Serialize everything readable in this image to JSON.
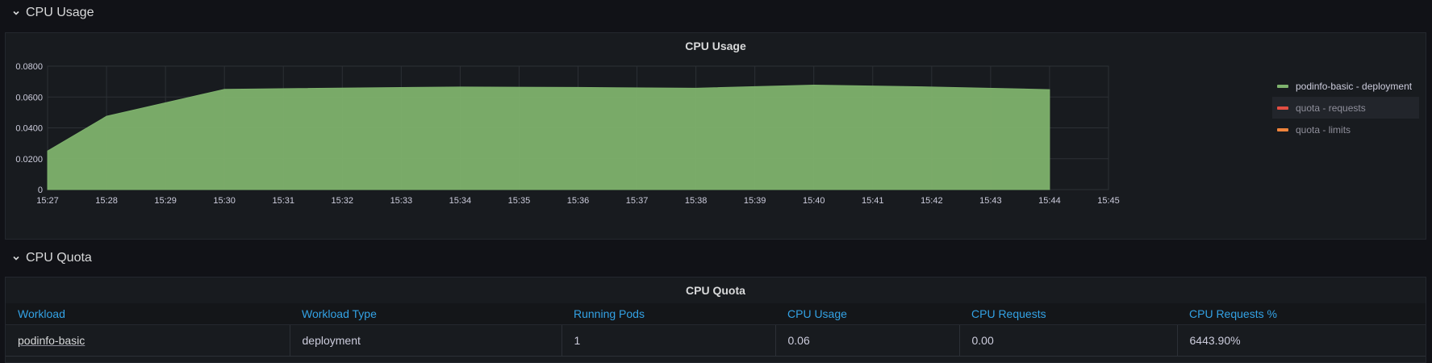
{
  "rows": {
    "cpu_usage": {
      "title": "CPU Usage"
    },
    "cpu_quota": {
      "title": "CPU Quota"
    }
  },
  "usage_panel": {
    "title": "CPU Usage",
    "legend": [
      {
        "label": "podinfo-basic - deployment",
        "color": "#7eb26d"
      },
      {
        "label": "quota - requests",
        "color": "#e24d42"
      },
      {
        "label": "quota - limits",
        "color": "#ef843c"
      }
    ]
  },
  "chart_data": {
    "type": "area",
    "title": "CPU Usage",
    "xlabel": "",
    "ylabel": "",
    "x_ticks": [
      "15:27",
      "15:28",
      "15:29",
      "15:30",
      "15:31",
      "15:32",
      "15:33",
      "15:34",
      "15:35",
      "15:36",
      "15:37",
      "15:38",
      "15:39",
      "15:40",
      "15:41",
      "15:42",
      "15:43",
      "15:44",
      "15:45"
    ],
    "y_ticks": [
      "0",
      "0.0200",
      "0.0400",
      "0.0600",
      "0.0800"
    ],
    "ylim": [
      0,
      0.08
    ],
    "grid": true,
    "legend_position": "right",
    "series": [
      {
        "name": "podinfo-basic - deployment",
        "color": "#7eb26d",
        "x": [
          "15:27",
          "15:28",
          "15:30",
          "15:34",
          "15:36",
          "15:38",
          "15:40",
          "15:42",
          "15:44"
        ],
        "values": [
          0.025,
          0.0475,
          0.065,
          0.0665,
          0.0662,
          0.0657,
          0.0677,
          0.0665,
          0.0648
        ]
      },
      {
        "name": "quota - requests",
        "color": "#e24d42",
        "x": [],
        "values": []
      },
      {
        "name": "quota - limits",
        "color": "#ef843c",
        "x": [],
        "values": []
      }
    ]
  },
  "quota_panel": {
    "title": "CPU Quota",
    "columns": [
      "Workload",
      "Workload Type",
      "Running Pods",
      "CPU Usage",
      "CPU Requests",
      "CPU Requests %"
    ],
    "rows": [
      [
        "podinfo-basic",
        "deployment",
        "1",
        "0.06",
        "0.00",
        "6443.90%"
      ]
    ]
  }
}
